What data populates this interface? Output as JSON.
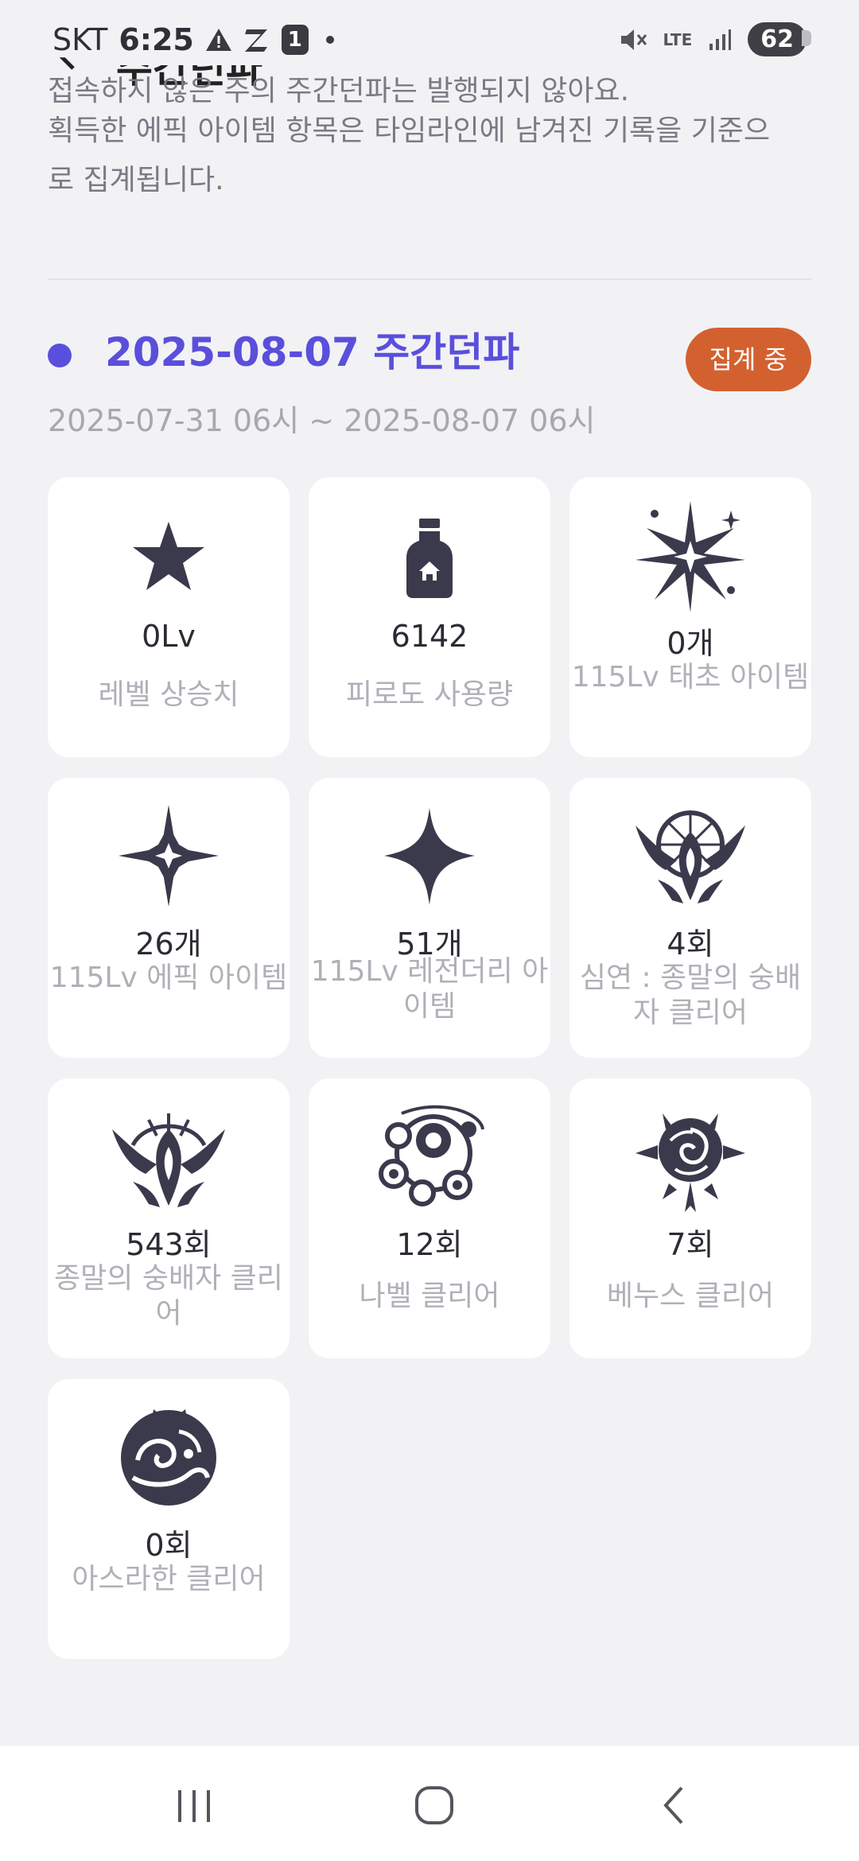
{
  "status_bar": {
    "carrier": "SKT",
    "time": "6:25",
    "notification_badge": "1",
    "network": "LTE",
    "battery": "62"
  },
  "header": {
    "title_fragment": "주간던파"
  },
  "notice": {
    "line_cut": "접속하지 않은 주의 주간던파는 발행되지 않아요.",
    "line_1": "획득한 에픽 아이템 항목은 타임라인에 남겨진 기록을 기준으",
    "line_2": "로 집계됩니다."
  },
  "week": {
    "title": "2025-08-07 주간던파",
    "status": "집계 중",
    "range": "2025-07-31 06시 ~ 2025-08-07 06시",
    "accent_color": "#5a4fdc",
    "status_color": "#d2612f"
  },
  "stats": [
    {
      "icon": "star-icon",
      "value": "0Lv",
      "label": "레벨 상승치"
    },
    {
      "icon": "potion-bottle-icon",
      "value": "6142",
      "label": "피로도 사용량"
    },
    {
      "icon": "burst-star-icon",
      "value": "0개",
      "label": "115Lv 태초 아이템"
    },
    {
      "icon": "sparkle-epic-icon",
      "value": "26개",
      "label": "115Lv 에픽 아이템"
    },
    {
      "icon": "four-point-star-icon",
      "value": "51개",
      "label": "115Lv 레전더리 아이템"
    },
    {
      "icon": "abyss-crest-icon",
      "value": "4회",
      "label": "심연 : 종말의 숭배자 클리어"
    },
    {
      "icon": "doom-crest-icon",
      "value": "543회",
      "label": "종말의 숭배자 클리어"
    },
    {
      "icon": "nabel-orb-icon",
      "value": "12회",
      "label": "나벨 클리어"
    },
    {
      "icon": "venus-rose-icon",
      "value": "7회",
      "label": "베누스 클리어"
    },
    {
      "icon": "asrahan-wave-icon",
      "value": "0회",
      "label": "아스라한 클리어"
    }
  ],
  "nav": {
    "recents": "recents-icon",
    "home": "home-icon",
    "back": "back-icon"
  }
}
